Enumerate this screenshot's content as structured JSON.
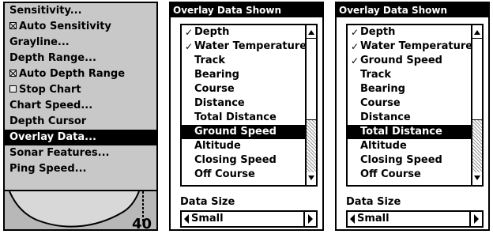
{
  "menu": {
    "items": [
      {
        "label": "Sensitivity...",
        "checkbox": false,
        "checked": false,
        "selected": false
      },
      {
        "label": "Auto Sensitivity",
        "checkbox": true,
        "checked": true,
        "selected": false
      },
      {
        "label": "Grayline...",
        "checkbox": false,
        "checked": false,
        "selected": false
      },
      {
        "label": "Depth Range...",
        "checkbox": false,
        "checked": false,
        "selected": false
      },
      {
        "label": "Auto Depth Range",
        "checkbox": true,
        "checked": true,
        "selected": false
      },
      {
        "label": "Stop Chart",
        "checkbox": true,
        "checked": false,
        "selected": false
      },
      {
        "label": "Chart Speed...",
        "checkbox": false,
        "checked": false,
        "selected": false
      },
      {
        "label": "Depth Cursor",
        "checkbox": false,
        "checked": false,
        "selected": false
      },
      {
        "label": "Overlay Data...",
        "checkbox": false,
        "checked": false,
        "selected": true
      },
      {
        "label": "Sonar Features...",
        "checkbox": false,
        "checked": false,
        "selected": false
      },
      {
        "label": "Ping Speed...",
        "checkbox": false,
        "checked": false,
        "selected": false
      }
    ],
    "depth_value": "40"
  },
  "panels": [
    {
      "title": "Overlay Data Shown",
      "items": [
        {
          "label": "Depth",
          "checked": true,
          "selected": false
        },
        {
          "label": "Water Temperature",
          "checked": true,
          "selected": false
        },
        {
          "label": "Track",
          "checked": false,
          "selected": false
        },
        {
          "label": "Bearing",
          "checked": false,
          "selected": false
        },
        {
          "label": "Course",
          "checked": false,
          "selected": false
        },
        {
          "label": "Distance",
          "checked": false,
          "selected": false
        },
        {
          "label": "Total Distance",
          "checked": false,
          "selected": false
        },
        {
          "label": "Ground Speed",
          "checked": false,
          "selected": true
        },
        {
          "label": "Altitude",
          "checked": false,
          "selected": false
        },
        {
          "label": "Closing Speed",
          "checked": false,
          "selected": false
        },
        {
          "label": "Off Course",
          "checked": false,
          "selected": false
        }
      ],
      "scroll_position": 0.0,
      "data_size_label": "Data Size",
      "data_size_value": "Small"
    },
    {
      "title": "Overlay Data Shown",
      "items": [
        {
          "label": "Depth",
          "checked": true,
          "selected": false
        },
        {
          "label": "Water Temperature",
          "checked": true,
          "selected": false
        },
        {
          "label": "Ground Speed",
          "checked": true,
          "selected": false
        },
        {
          "label": "Track",
          "checked": false,
          "selected": false
        },
        {
          "label": "Bearing",
          "checked": false,
          "selected": false
        },
        {
          "label": "Course",
          "checked": false,
          "selected": false
        },
        {
          "label": "Distance",
          "checked": false,
          "selected": false
        },
        {
          "label": "Total Distance",
          "checked": false,
          "selected": true
        },
        {
          "label": "Altitude",
          "checked": false,
          "selected": false
        },
        {
          "label": "Closing Speed",
          "checked": false,
          "selected": false
        },
        {
          "label": "Off Course",
          "checked": false,
          "selected": false
        }
      ],
      "scroll_position": 0.0,
      "data_size_label": "Data Size",
      "data_size_value": "Small"
    }
  ]
}
